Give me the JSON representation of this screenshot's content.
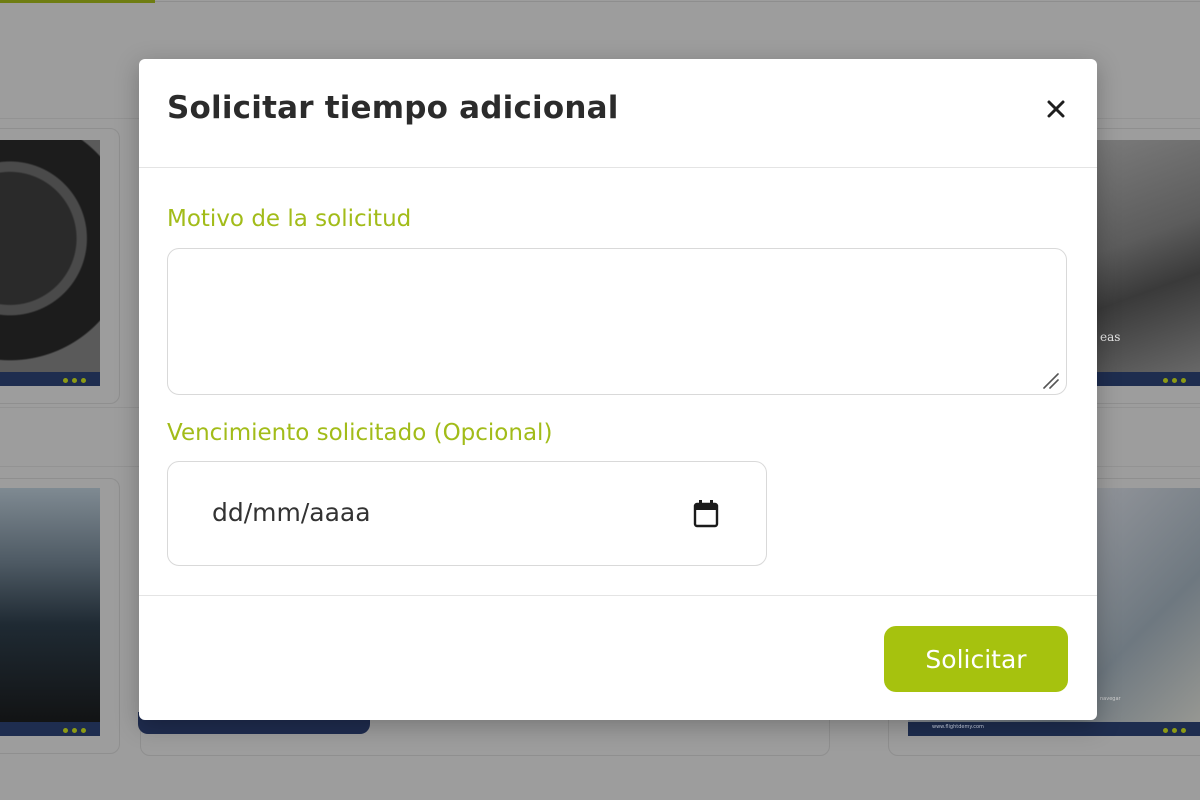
{
  "modal": {
    "title": "Solicitar tiempo adicional",
    "close_icon": "close-icon",
    "motivo_label": "Motivo de la solicitud",
    "motivo_value": "",
    "vencimiento_label": "Vencimiento solicitado (Opcional)",
    "date_placeholder": "dd/mm/aaaa",
    "calendar_icon": "calendar-icon",
    "submit_label": "Solicitar"
  },
  "background": {
    "thumb_fragment_right_top": "eas",
    "thumb_credit_right_bottom": "www.flightdemy.com",
    "thumb_fragment_right_bottom": "navegar"
  },
  "colors": {
    "accent_green": "#a6c20e",
    "label_green": "#a2bc19",
    "title_text": "#2b2b2b",
    "navy": "#1f2c4f"
  }
}
